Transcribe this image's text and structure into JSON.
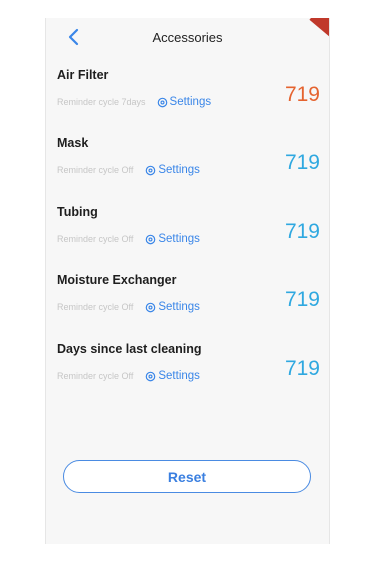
{
  "header": {
    "title": "Accessories",
    "back_icon": "chevron-left-icon"
  },
  "colors": {
    "accent": "#3a86e8",
    "count_normal": "#2fa8e0",
    "count_alert": "#e5632f",
    "background": "#f7f7f7"
  },
  "items": [
    {
      "name": "Air Filter",
      "cycle": "Reminder cycle 7days",
      "settings_label": "Settings",
      "count": "719",
      "alert": true
    },
    {
      "name": "Mask",
      "cycle": "Reminder cycle Off",
      "settings_label": "Settings",
      "count": "719",
      "alert": false
    },
    {
      "name": "Tubing",
      "cycle": "Reminder cycle Off",
      "settings_label": "Settings",
      "count": "719",
      "alert": false
    },
    {
      "name": "Moisture Exchanger",
      "cycle": "Reminder cycle Off",
      "settings_label": "Settings",
      "count": "719",
      "alert": false
    },
    {
      "name": "Days since last cleaning",
      "cycle": "Reminder cycle Off",
      "settings_label": "Settings",
      "count": "719",
      "alert": false
    }
  ],
  "reset_label": "Reset"
}
